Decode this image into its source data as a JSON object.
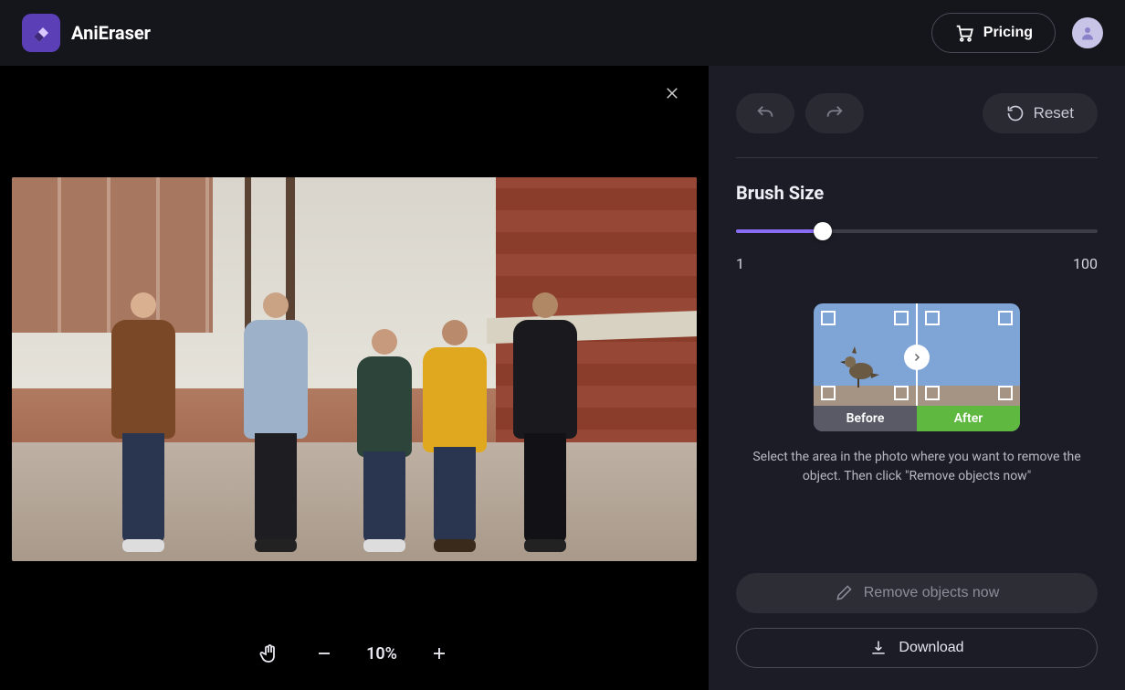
{
  "header": {
    "brand": "AniEraser",
    "pricing_label": "Pricing"
  },
  "canvas": {
    "zoom_level": "10%"
  },
  "sidebar": {
    "reset_label": "Reset",
    "brush_size": {
      "title": "Brush Size",
      "min": "1",
      "max": "100",
      "value_percent": 24
    },
    "demo": {
      "before_label": "Before",
      "after_label": "After"
    },
    "hint": "Select the area in the photo where you want to remove the object. Then click \"Remove objects now\"",
    "remove_label": "Remove objects now",
    "download_label": "Download"
  },
  "colors": {
    "accent": "#8b6cf5",
    "success": "#5fb83f"
  }
}
